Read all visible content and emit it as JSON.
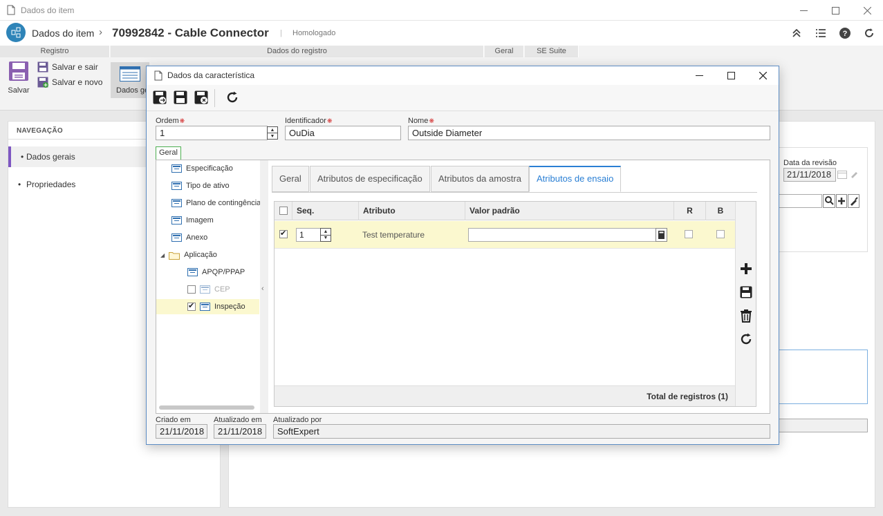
{
  "window": {
    "title": "Dados do item"
  },
  "header": {
    "crumb_root": "Dados do item",
    "crumb_sep": "›",
    "item_title": "70992842 - Cable Connector",
    "status": "Homologado"
  },
  "ribbon": {
    "groups": [
      "Registro",
      "Dados do registro",
      "Geral",
      "SE Suite"
    ],
    "save_label": "Salvar",
    "save_exit_label": "Salvar e sair",
    "save_new_label": "Salvar e novo",
    "dados_geral_label": "Dados ge"
  },
  "nav": {
    "header": "NAVEGAÇÃO",
    "items": [
      {
        "label": "Dados gerais"
      },
      {
        "label": "Propriedades"
      }
    ]
  },
  "background": {
    "revision_date_label": "Data da revisão",
    "revision_date_value": "21/11/2018"
  },
  "modal": {
    "title": "Dados da característica",
    "fields": {
      "ordem_label": "Ordem",
      "ordem_value": "1",
      "identificador_label": "Identificador",
      "identificador_value": "OuDia",
      "nome_label": "Nome",
      "nome_value": "Outside Diameter"
    },
    "main_tab": "Geral",
    "tree": [
      {
        "label": "Especificação"
      },
      {
        "label": "Tipo de ativo"
      },
      {
        "label": "Plano de contingência"
      },
      {
        "label": "Imagem"
      },
      {
        "label": "Anexo"
      },
      {
        "label": "Aplicação"
      },
      {
        "label": "APQP/PPAP"
      },
      {
        "label": "CEP",
        "checked": false
      },
      {
        "label": "Inspeção",
        "checked": true
      }
    ],
    "sub_tabs": [
      "Geral",
      "Atributos de especificação",
      "Atributos da amostra",
      "Atributos de ensaio"
    ],
    "active_sub_tab": "Atributos de ensaio",
    "grid": {
      "columns": [
        "Seq.",
        "Atributo",
        "Valor padrão",
        "R",
        "B"
      ],
      "rows": [
        {
          "checked": true,
          "seq": "1",
          "atributo": "Test temperature",
          "valor_padrao": "",
          "r": false,
          "b": false
        }
      ],
      "footer": "Total de registros (1)"
    },
    "footer": {
      "criado_label": "Criado em",
      "criado_value": "21/11/2018",
      "atualizado_label": "Atualizado em",
      "atualizado_value": "21/11/2018",
      "atualizado_por_label": "Atualizado por",
      "atualizado_por_value": "SoftExpert"
    }
  },
  "colors": {
    "accent": "#2a7fd4",
    "nav_active": "#7e57c2",
    "selected_row": "#fbf8cf",
    "required": "#d32f2f"
  }
}
